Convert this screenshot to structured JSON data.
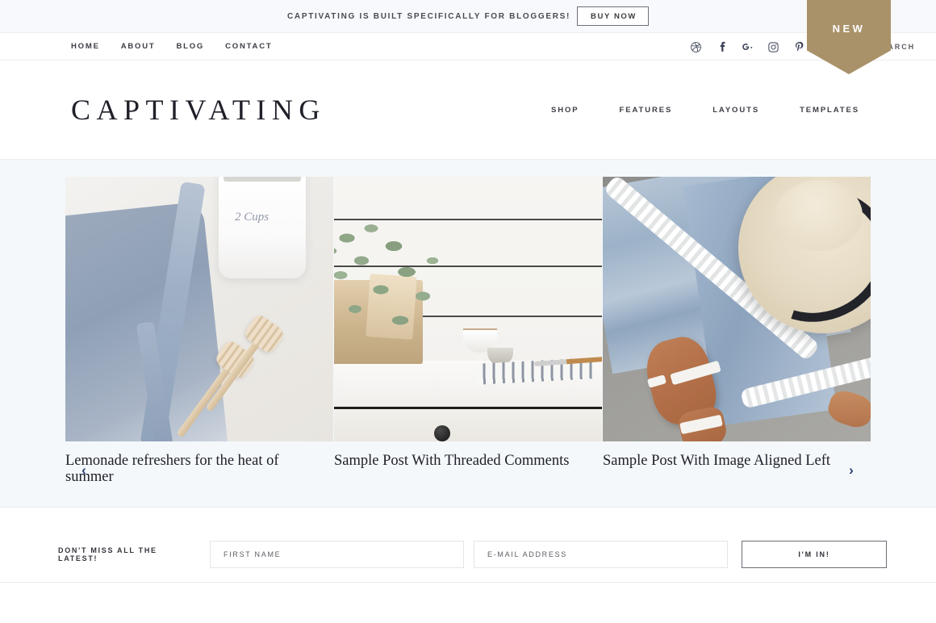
{
  "promo": {
    "text": "CAPTIVATING IS BUILT SPECIFICALLY FOR BLOGGERS!",
    "button_label": "BUY NOW"
  },
  "ribbon": {
    "label": "NEW",
    "color": "#a99269"
  },
  "utility_nav": {
    "items": [
      {
        "label": "HOME"
      },
      {
        "label": "ABOUT"
      },
      {
        "label": "BLOG"
      },
      {
        "label": "CONTACT"
      }
    ],
    "social": [
      {
        "name": "dribbble-icon"
      },
      {
        "name": "facebook-icon"
      },
      {
        "name": "google-plus-icon"
      },
      {
        "name": "instagram-icon"
      },
      {
        "name": "pinterest-icon"
      },
      {
        "name": "twitter-icon"
      },
      {
        "name": "youtube-icon"
      }
    ],
    "search_label": "SEARCH"
  },
  "header": {
    "logo": "CAPTIVATING",
    "nav": [
      {
        "label": "SHOP"
      },
      {
        "label": "FEATURES"
      },
      {
        "label": "LAYOUTS"
      },
      {
        "label": "TEMPLATES"
      }
    ]
  },
  "slider": {
    "prev_label": "‹",
    "next_label": "›",
    "slides": [
      {
        "title": "Lemonade refreshers for the heat of summer",
        "alt": "denim cloth, white jug and wooden honey dippers"
      },
      {
        "title": "Sample Post With Threaded Comments",
        "alt": "wooden crate with plant on white kitchen counter"
      },
      {
        "title": "Sample Post With Image Aligned Left",
        "alt": "straw hat, blue beach towel and tan sandals"
      }
    ]
  },
  "newsletter": {
    "label": "DON'T MISS ALL THE LATEST!",
    "first_name_placeholder": "FIRST NAME",
    "email_placeholder": "E-MAIL ADDRESS",
    "submit_label": "I'M IN!"
  },
  "colors": {
    "accent_gold": "#a99269",
    "slider_bg": "#f4f8fb",
    "promo_bg": "#f7f9fc",
    "text_dark": "#20202a"
  }
}
